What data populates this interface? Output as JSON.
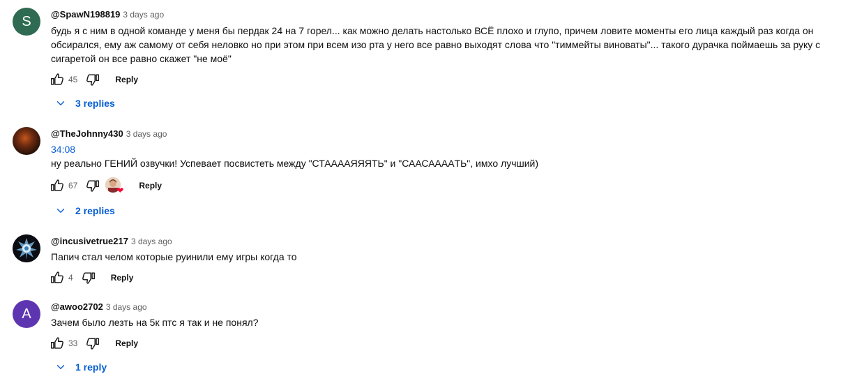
{
  "comments": [
    {
      "author": "@SpawN198819",
      "time": "3 days ago",
      "avatar_letter": "S",
      "avatar_color": "#2e6b52",
      "text": "будь я с ним в одной команде у меня бы пердак 24 на 7 горел... как можно делать настолько ВСЁ плохо и глупо, причем ловите моменты его лица каждый раз когда он обсирался, ему аж самому от себя неловко но при этом при всем изо рта у него все равно выходят слова что \"тиммейты виноваты\"... такого дурачка поймаешь за руку с сигаретой он все равно скажет \"не моё\"",
      "likes": "45",
      "reply_label": "Reply",
      "replies_label": "3 replies"
    },
    {
      "author": "@TheJohnny430",
      "time": "3 days ago",
      "timestamp": "34:08",
      "text": "ну реально ГЕНИЙ озвучки! Успевает посвистеть между \"СТАААAЯЯЯТЬ\" и \"СААСАААAТЬ\", имхо лучший)",
      "likes": "67",
      "reply_label": "Reply",
      "replies_label": "2 replies"
    },
    {
      "author": "@incusivetrue217",
      "time": "3 days ago",
      "text": "Папич стал челом которые руинили ему игры когда то",
      "likes": "4",
      "reply_label": "Reply"
    },
    {
      "author": "@awoo2702",
      "time": "3 days ago",
      "avatar_letter": "A",
      "avatar_color": "#5e35b1",
      "text": "Зачем было лезть на 5к птс я так и не понял?",
      "likes": "33",
      "reply_label": "Reply",
      "replies_label": "1 reply"
    }
  ],
  "icons": {
    "like": "thumbs-up-icon",
    "dislike": "thumbs-down-icon",
    "expand": "chevron-down-icon",
    "creator_heart": "heart-icon"
  },
  "colors": {
    "link_blue": "#065fd4",
    "heart_red": "#ff0033"
  }
}
